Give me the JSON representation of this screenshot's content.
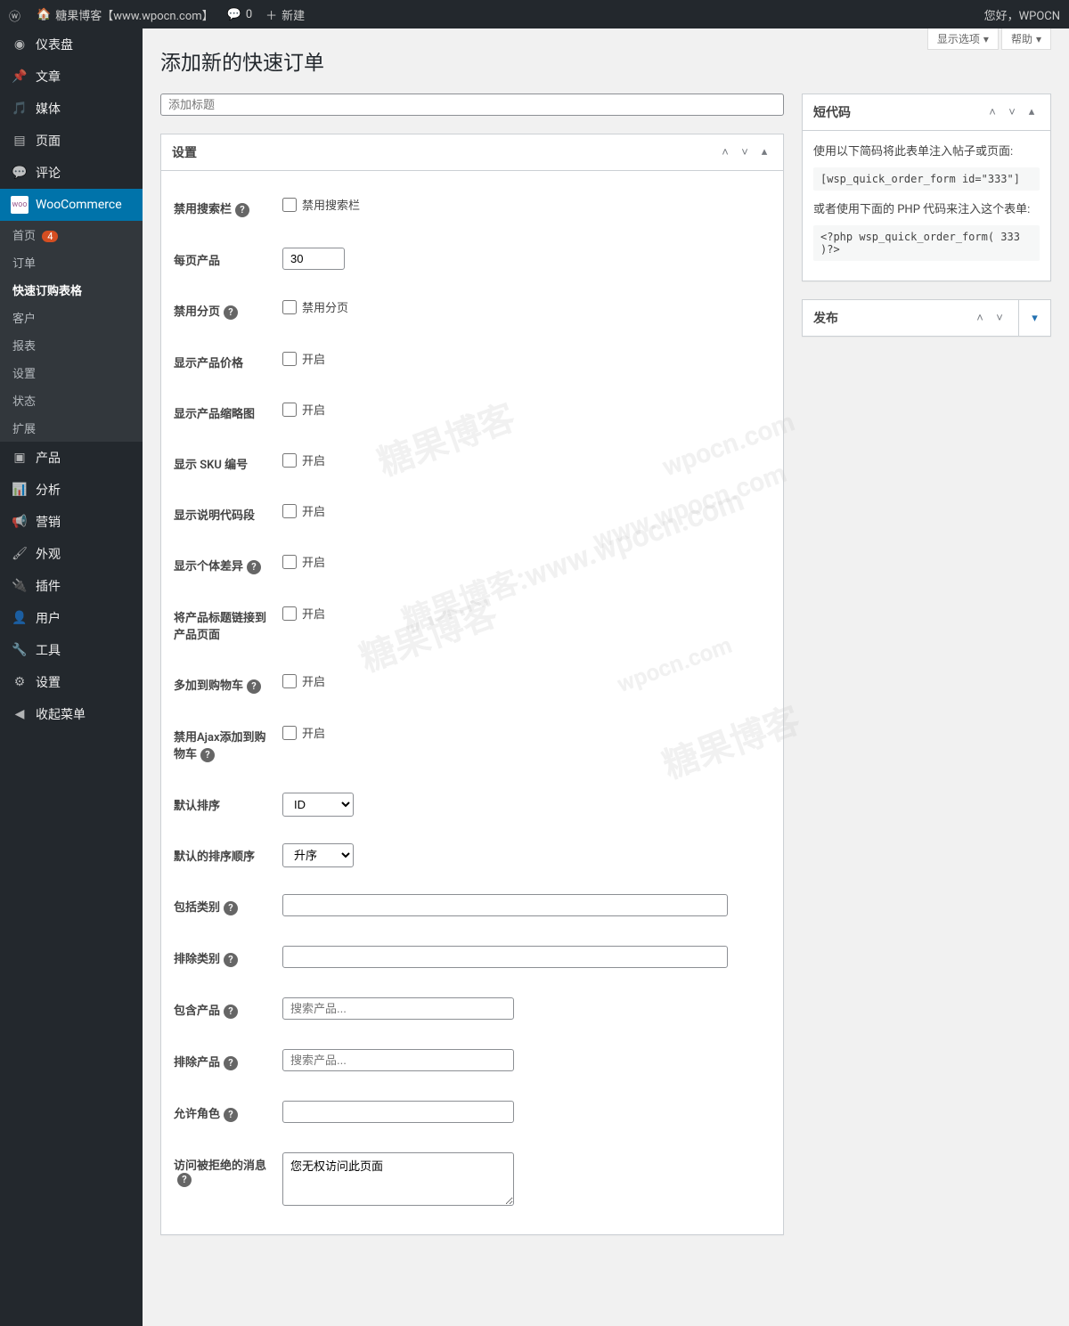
{
  "adminbar": {
    "site_name": "糖果博客【www.wpocn.com】",
    "comments": "0",
    "new": "新建",
    "greeting": "您好，WPOCN"
  },
  "menu": {
    "dashboard": "仪表盘",
    "posts": "文章",
    "media": "媒体",
    "pages": "页面",
    "comments": "评论",
    "woocommerce": "WooCommerce",
    "wc_home": "首页",
    "wc_home_badge": "4",
    "wc_orders": "订单",
    "wc_quick_order": "快速订购表格",
    "wc_customers": "客户",
    "wc_reports": "报表",
    "wc_settings": "设置",
    "wc_status": "状态",
    "wc_extensions": "扩展",
    "products": "产品",
    "analytics": "分析",
    "marketing": "营销",
    "appearance": "外观",
    "plugins": "插件",
    "users": "用户",
    "tools": "工具",
    "settings": "设置",
    "collapse": "收起菜单"
  },
  "screen": {
    "options": "显示选项",
    "help": "帮助"
  },
  "page": {
    "title": "添加新的快速订单",
    "title_placeholder": "添加标题"
  },
  "settings_box": {
    "heading": "设置",
    "disable_search": {
      "label": "禁用搜索栏",
      "check": "禁用搜索栏"
    },
    "per_page": {
      "label": "每页产品",
      "value": "30"
    },
    "disable_paging": {
      "label": "禁用分页",
      "check": "禁用分页"
    },
    "show_price": {
      "label": "显示产品价格",
      "check": "开启"
    },
    "show_thumb": {
      "label": "显示产品缩略图",
      "check": "开启"
    },
    "show_sku": {
      "label": "显示 SKU 编号",
      "check": "开启"
    },
    "show_desc": {
      "label": "显示说明代码段",
      "check": "开启"
    },
    "show_variations": {
      "label": "显示个体差异",
      "check": "开启"
    },
    "link_title": {
      "label": "将产品标题链接到产品页面",
      "check": "开启"
    },
    "multi_cart": {
      "label": "多加到购物车",
      "check": "开启"
    },
    "disable_ajax": {
      "label": "禁用Ajax添加到购物车",
      "check": "开启"
    },
    "default_sort": {
      "label": "默认排序",
      "value": "ID"
    },
    "sort_order": {
      "label": "默认的排序顺序",
      "value": "升序"
    },
    "include_cat": {
      "label": "包括类别"
    },
    "exclude_cat": {
      "label": "排除类别"
    },
    "include_prod": {
      "label": "包含产品",
      "placeholder": "搜索产品..."
    },
    "exclude_prod": {
      "label": "排除产品",
      "placeholder": "搜索产品..."
    },
    "allow_roles": {
      "label": "允许角色"
    },
    "denied_msg": {
      "label": "访问被拒绝的消息",
      "value": "您无权访问此页面"
    }
  },
  "shortcode_box": {
    "heading": "短代码",
    "intro": "使用以下简码将此表单注入帖子或页面:",
    "shortcode": "[wsp_quick_order_form id=\"333\"]",
    "php_intro": "或者使用下面的 PHP 代码来注入这个表单:",
    "php_code": "<?php wsp_quick_order_form( 333 )?>"
  },
  "publish_box": {
    "heading": "发布"
  },
  "watermarks": [
    "糖果博客",
    "wpocn.com",
    "糖果博客:www.wpocn.com",
    "www.wpocn.com",
    "糖果博客",
    "wpocn.com",
    "糖果博客"
  ]
}
